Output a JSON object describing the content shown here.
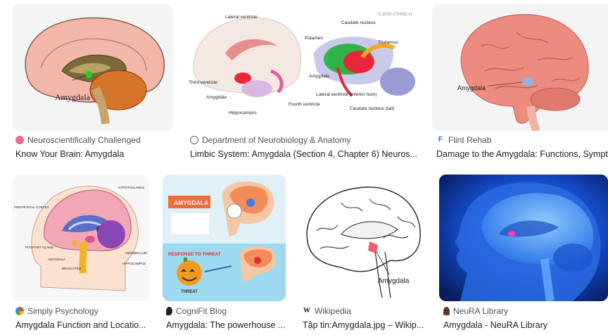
{
  "results": [
    {
      "source": "Neuroscientifically Challenged",
      "title": "Know Your Brain: Amygdala",
      "favicon": "brain-favicon-icon",
      "image_labels": [
        "Amygdala"
      ]
    },
    {
      "source": "Department of Neurobiology & Anatomy",
      "title": "Limbic System: Amygdala (Section 4, Chapter 6) Neuros...",
      "favicon": "globe-icon",
      "image_labels": [
        "Lateral ventricle",
        "Third ventricle",
        "Amygdala",
        "Hippocampus",
        "Fourth ventricle",
        "Putamen",
        "Caudate nucleus",
        "Thalamus",
        "Amygdala",
        "Lateral ventricle (inferior horn)",
        "Caudate nucleus (tail)",
        "© 2010 UTHSC-H"
      ]
    },
    {
      "source": "Flint Rehab",
      "title": "Damage to the Amygdala: Functions, Sympto...",
      "favicon": "flint-f-icon",
      "image_labels": [
        "Amygdala"
      ]
    },
    {
      "source": "Simply Psychology",
      "title": "Amygdala Function and Locatio...",
      "favicon": "simply-psychology-icon",
      "image_labels": [
        "PREFRONTAL CORTEX",
        "HYPOTHALAMUS",
        "PITUITARY GLAND",
        "AMYGDALA",
        "BRAIN STEM",
        "CEREBELLUM",
        "HIPPOCAMPUS"
      ]
    },
    {
      "source": "CogniFit Blog",
      "title": "Amygdala: The powerhouse ...",
      "favicon": "cognifit-icon",
      "image_labels": [
        "AMYGDALA",
        "RESPONSE TO THREAT",
        "THREAT"
      ]
    },
    {
      "source": "Wikipedia",
      "title": "Tập tin:Amygdala.jpg – Wikip...",
      "favicon": "wikipedia-w-icon",
      "image_labels": [
        "Amygdala"
      ]
    },
    {
      "source": "NeuRA Library",
      "title": "Amygdala - NeuRA Library",
      "favicon": "neura-icon",
      "image_labels": []
    }
  ]
}
